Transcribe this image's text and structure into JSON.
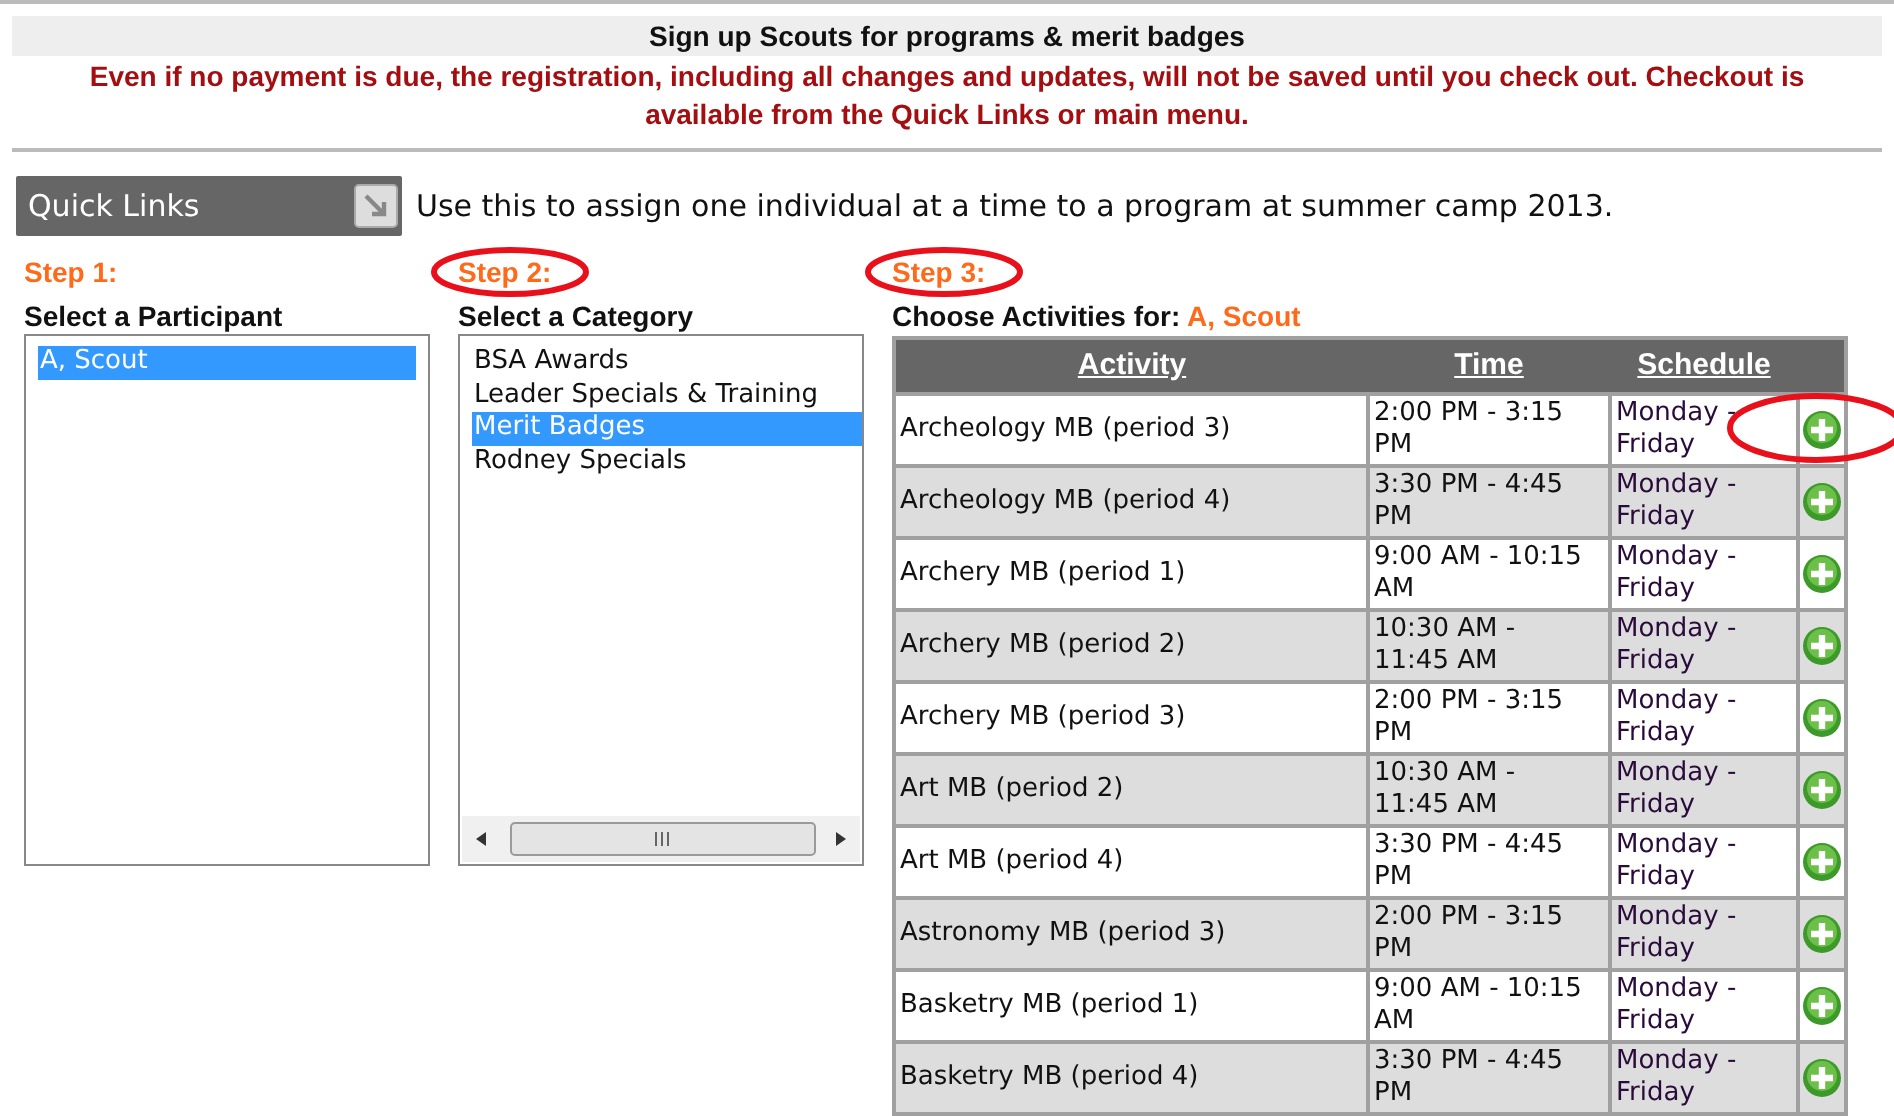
{
  "header": {
    "title": "Sign up Scouts for programs & merit badges",
    "notice": "Even if no payment is due, the registration, including all changes and updates, will not be saved until you check out. Checkout is available from the Quick Links or main menu."
  },
  "quick_links": {
    "label": "Quick Links",
    "hint": "Use this to assign one individual at a time to a program at summer camp 2013."
  },
  "steps": [
    {
      "step": "Step 1:",
      "title": "Select a Participant",
      "circled": false,
      "horizontal_scrollbar": false,
      "items": [
        {
          "label": "A, Scout",
          "selected": true
        }
      ]
    },
    {
      "step": "Step 2:",
      "title": "Select a Category",
      "circled": true,
      "horizontal_scrollbar": true,
      "items": [
        {
          "label": "BSA Awards",
          "selected": false
        },
        {
          "label": "Leader Specials & Training",
          "selected": false
        },
        {
          "label": "Merit Badges",
          "selected": true
        },
        {
          "label": "Rodney Specials",
          "selected": false
        }
      ]
    }
  ],
  "activities": {
    "step": "Step 3:",
    "circled": true,
    "title": "Choose Activities for:",
    "participant": "A, Scout",
    "columns": [
      "Activity",
      "Time",
      "Schedule"
    ],
    "rows": [
      {
        "activity": "Archeology MB (period 3)",
        "time": "2:00 PM - 3:15 PM",
        "schedule": "Monday - Friday",
        "circled": true
      },
      {
        "activity": "Archeology MB (period 4)",
        "time": "3:30 PM - 4:45 PM",
        "schedule": "Monday - Friday",
        "circled": false
      },
      {
        "activity": "Archery MB (period 1)",
        "time": "9:00 AM - 10:15 AM",
        "schedule": "Monday - Friday",
        "circled": false
      },
      {
        "activity": "Archery MB (period 2)",
        "time": "10:30 AM - 11:45 AM",
        "schedule": "Monday - Friday",
        "circled": false
      },
      {
        "activity": "Archery MB (period 3)",
        "time": "2:00 PM - 3:15 PM",
        "schedule": "Monday - Friday",
        "circled": false
      },
      {
        "activity": "Art MB (period 2)",
        "time": "10:30 AM - 11:45 AM",
        "schedule": "Monday - Friday",
        "circled": false
      },
      {
        "activity": "Art MB (period 4)",
        "time": "3:30 PM - 4:45 PM",
        "schedule": "Monday - Friday",
        "circled": false
      },
      {
        "activity": "Astronomy MB (period 3)",
        "time": "2:00 PM - 3:15 PM",
        "schedule": "Monday - Friday",
        "circled": false
      },
      {
        "activity": "Basketry MB (period 1)",
        "time": "9:00 AM - 10:15 AM",
        "schedule": "Monday - Friday",
        "circled": false
      },
      {
        "activity": "Basketry MB (period 4)",
        "time": "3:30 PM - 4:45 PM",
        "schedule": "Monday - Friday",
        "circled": false
      }
    ]
  }
}
